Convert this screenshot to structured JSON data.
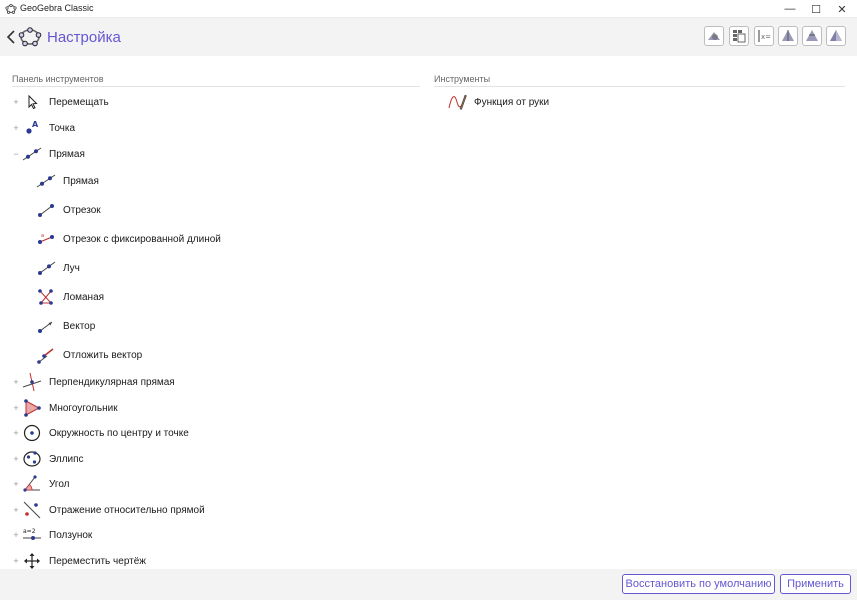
{
  "window": {
    "title": "GeoGebra Classic",
    "minimize_glyph": "—",
    "maximize_glyph": "☐",
    "close_glyph": "✕"
  },
  "header": {
    "back_glyph": "‹",
    "title": "Настройка",
    "accent_color": "#6557d2",
    "perspective_buttons": [
      "graphics-perspective-icon",
      "spreadsheet-perspective-icon",
      "algebra-perspective-icon",
      "3d-graphics-perspective-icon",
      "probability-perspective-icon",
      "cas-perspective-icon"
    ]
  },
  "toolbar_panel": {
    "heading": "Панель инструментов",
    "groups": [
      {
        "label": "Перемещать",
        "icon": "move-arrow-icon",
        "expander": "+"
      },
      {
        "label": "Точка",
        "icon": "point-icon",
        "expander": "+"
      },
      {
        "label": "Прямая",
        "icon": "line-icon",
        "expander": "−"
      },
      {
        "label": "Перпендикулярная прямая",
        "icon": "perpendicular-line-icon",
        "expander": "+"
      },
      {
        "label": "Многоугольник",
        "icon": "polygon-icon",
        "expander": "+"
      },
      {
        "label": "Окружность по центру и точке",
        "icon": "circle-center-point-icon",
        "expander": "+"
      },
      {
        "label": "Эллипс",
        "icon": "ellipse-icon",
        "expander": "+"
      },
      {
        "label": "Угол",
        "icon": "angle-icon",
        "expander": "+"
      },
      {
        "label": "Отражение относительно прямой",
        "icon": "reflect-line-icon",
        "expander": "+"
      },
      {
        "label": "Ползунок",
        "icon": "slider-icon",
        "expander": "+"
      },
      {
        "label": "Переместить чертёж",
        "icon": "move-graphics-icon",
        "expander": "+"
      }
    ],
    "line_children": [
      {
        "label": "Прямая",
        "icon": "line-icon"
      },
      {
        "label": "Отрезок",
        "icon": "segment-icon"
      },
      {
        "label": "Отрезок с фиксированной длиной",
        "icon": "segment-fixed-icon"
      },
      {
        "label": "Луч",
        "icon": "ray-icon"
      },
      {
        "label": "Ломаная",
        "icon": "polyline-icon"
      },
      {
        "label": "Вектор",
        "icon": "vector-icon"
      },
      {
        "label": "Отложить вектор",
        "icon": "vector-from-point-icon"
      }
    ]
  },
  "tools_panel": {
    "heading": "Инструменты",
    "items": [
      {
        "label": "Функция от руки",
        "icon": "freehand-function-icon"
      }
    ]
  },
  "footer": {
    "restore_default": "Восстановить по умолчанию",
    "apply": "Применить"
  }
}
